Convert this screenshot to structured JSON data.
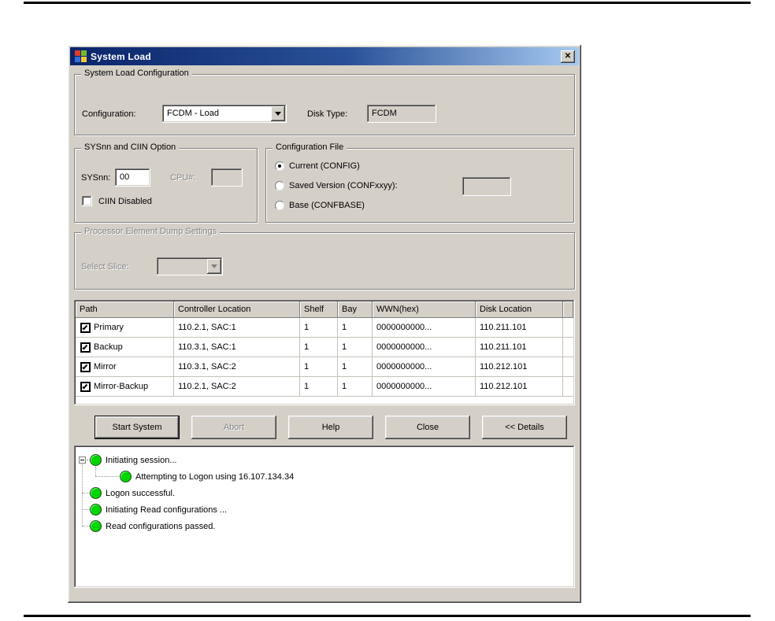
{
  "window": {
    "title": "System Load"
  },
  "icons": {
    "close": "✕"
  },
  "colors": {
    "titlebar_left": "#0a246a",
    "titlebar_right": "#a6caf0",
    "dialog_face": "#d4d0c8",
    "status_green": "#00d400"
  },
  "system_load_config": {
    "title": "System Load Configuration",
    "configuration_label": "Configuration:",
    "configuration_value": "FCDM - Load",
    "disk_type_label": "Disk Type:",
    "disk_type_value": "FCDM"
  },
  "sysnn_ciin": {
    "title": "SYSnn and CIIN Option",
    "sysnn_label": "SYSnn:",
    "sysnn_value": "00",
    "cpu_label": "CPU#:",
    "cpu_value": "",
    "ciin_label": "CIIN Disabled",
    "ciin_checked": false
  },
  "config_file": {
    "title": "Configuration File",
    "options": [
      {
        "label": "Current (CONFIG)",
        "selected": true
      },
      {
        "label": "Saved Version (CONFxxyy):",
        "selected": false,
        "field_value": ""
      },
      {
        "label": "Base (CONFBASE)",
        "selected": false
      }
    ]
  },
  "dump_settings": {
    "title": "Processor Element Dump Settings",
    "select_slice_label": "Select Slice:",
    "select_slice_value": "",
    "disabled": true
  },
  "table": {
    "columns": [
      "Path",
      "Controller Location",
      "Shelf",
      "Bay",
      "WWN(hex)",
      "Disk Location"
    ],
    "rows": [
      {
        "checked": true,
        "path": "Primary",
        "controller": "110.2.1, SAC:1",
        "shelf": "1",
        "bay": "1",
        "wwn": "0000000000...",
        "disk": "110.211.101"
      },
      {
        "checked": true,
        "path": "Backup",
        "controller": "110.3.1, SAC:1",
        "shelf": "1",
        "bay": "1",
        "wwn": "0000000000...",
        "disk": "110.211.101"
      },
      {
        "checked": true,
        "path": "Mirror",
        "controller": "110.3.1, SAC:2",
        "shelf": "1",
        "bay": "1",
        "wwn": "0000000000...",
        "disk": "110.212.101"
      },
      {
        "checked": true,
        "path": "Mirror-Backup",
        "controller": "110.2.1, SAC:2",
        "shelf": "1",
        "bay": "1",
        "wwn": "0000000000...",
        "disk": "110.212.101"
      }
    ]
  },
  "buttons": [
    {
      "label": "Start System",
      "state": "default"
    },
    {
      "label": "Abort",
      "state": "disabled"
    },
    {
      "label": "Help",
      "state": "normal"
    },
    {
      "label": "Close",
      "state": "normal"
    },
    {
      "label": "<< Details",
      "state": "normal"
    }
  ],
  "log": {
    "items": [
      {
        "text": "Initiating session...",
        "level": 0,
        "expanded": true
      },
      {
        "text": "Attempting to Logon using 16.107.134.34",
        "level": 1
      },
      {
        "text": "Logon successful.",
        "level": 0
      },
      {
        "text": "Initiating Read configurations ...",
        "level": 0
      },
      {
        "text": "Read configurations passed.",
        "level": 0
      }
    ]
  }
}
